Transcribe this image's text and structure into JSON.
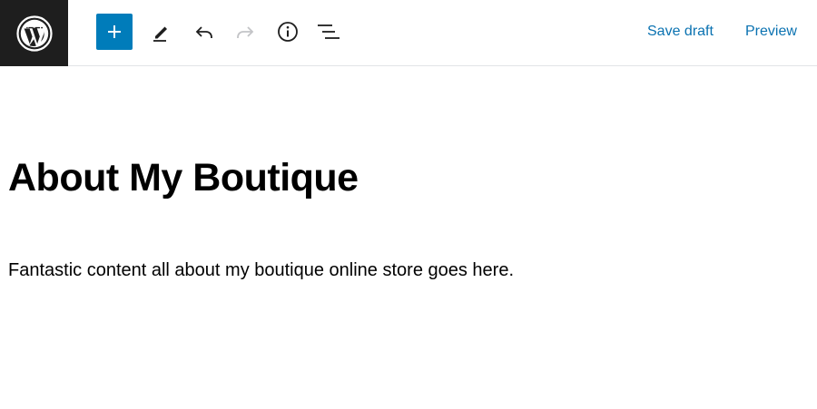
{
  "toolbar": {
    "add_block_icon": "plus-icon",
    "tools_icon": "pencil-icon",
    "undo_icon": "undo-icon",
    "redo_icon": "redo-icon",
    "details_icon": "info-icon",
    "outline_icon": "list-view-icon",
    "save_draft_label": "Save draft",
    "preview_label": "Preview"
  },
  "logo": {
    "icon": "wordpress-logo-icon"
  },
  "editor": {
    "title": "About My Boutique",
    "paragraph": "Fantastic content all about my boutique online store goes here."
  },
  "colors": {
    "accent": "#007cba",
    "link": "#0a72b1",
    "logo_bg": "#1e1e1e",
    "disabled": "#c3c4c7"
  }
}
